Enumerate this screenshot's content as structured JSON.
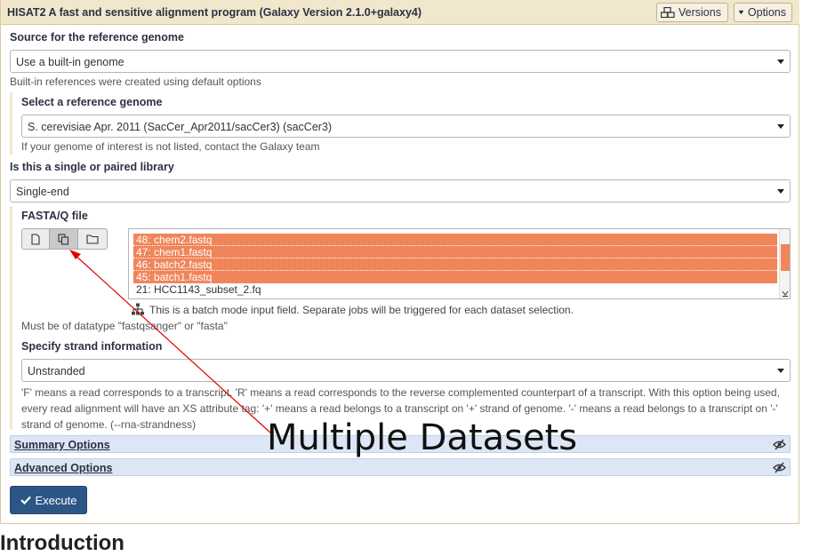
{
  "header": {
    "tool_title": "HISAT2 A fast and sensitive alignment program (Galaxy Version 2.1.0+galaxy4)",
    "versions_label": "Versions",
    "options_label": "Options"
  },
  "source": {
    "label": "Source for the reference genome",
    "value": "Use a built-in genome",
    "help": "Built-in references were created using default options"
  },
  "reference": {
    "label": "Select a reference genome",
    "value": "S. cerevisiae Apr. 2011 (SacCer_Apr2011/sacCer3) (sacCer3)",
    "help": "If your genome of interest is not listed, contact the Galaxy team"
  },
  "library": {
    "label": "Is this a single or paired library",
    "value": "Single-end"
  },
  "fastaq": {
    "label": "FASTA/Q file",
    "options": [
      {
        "text": "48: chem2.fastq",
        "selected": true
      },
      {
        "text": "47: chem1.fastq",
        "selected": true
      },
      {
        "text": "46: batch2.fastq",
        "selected": true
      },
      {
        "text": "45: batch1.fastq",
        "selected": true
      },
      {
        "text": "21: HCC1143_subset_2.fq",
        "selected": false
      }
    ],
    "batch_note": "This is a batch mode input field. Separate jobs will be triggered for each dataset selection.",
    "help": "Must be of datatype \"fastqsanger\" or \"fasta\""
  },
  "strand": {
    "label": "Specify strand information",
    "value": "Unstranded",
    "help": "'F' means a read corresponds to a transcript. 'R' means a read corresponds to the reverse complemented counterpart of a transcript. With this option being used, every read alignment will have an XS attribute tag: '+' means a read belongs to a transcript on '+' strand of genome. '-' means a read belongs to a transcript on '-' strand of genome. (--rna-strandness)"
  },
  "sections": {
    "summary": "Summary Options",
    "advanced": "Advanced Options"
  },
  "execute_label": "Execute",
  "intro_heading": "Introduction",
  "annotation": "Multiple Datasets",
  "colors": {
    "header_bg": "#f0e7cc",
    "selection": "#f0855a",
    "section_bg": "#dce6f5",
    "execute_bg": "#2c5685",
    "annotation_arrow": "#e00000"
  }
}
